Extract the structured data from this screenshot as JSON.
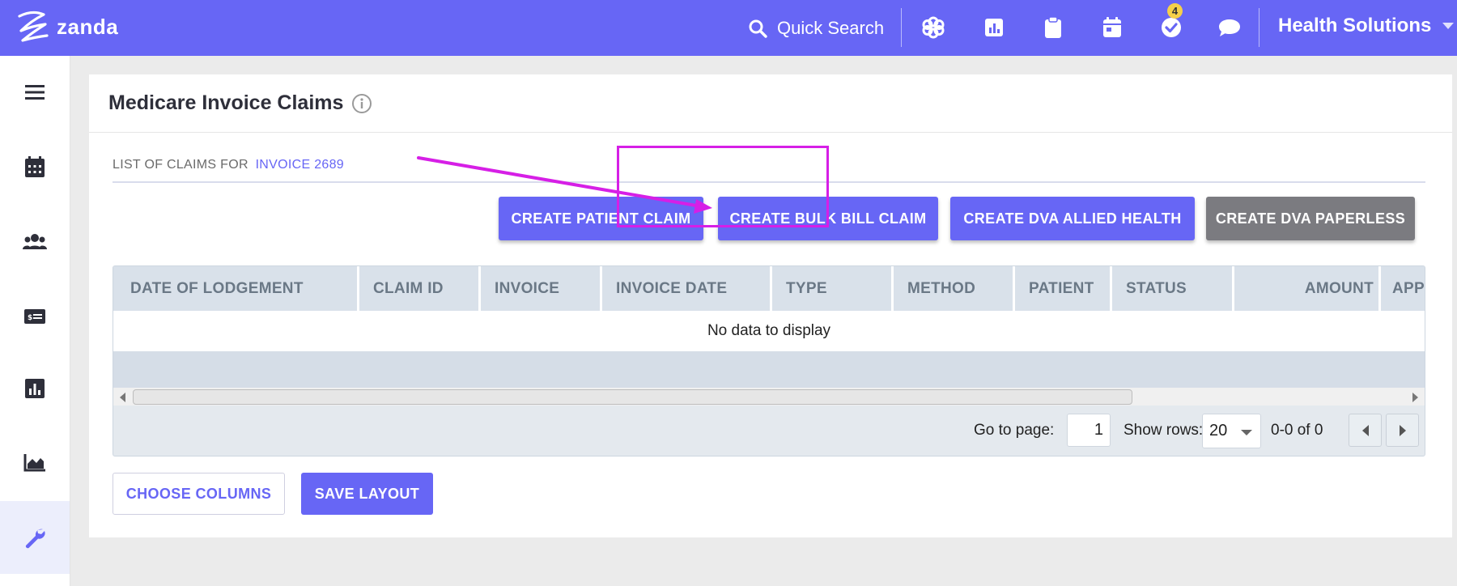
{
  "topbar": {
    "logo_text": "zanda",
    "quick_search_label": "Quick Search",
    "notification_count": "4",
    "org_name": "Health Solutions",
    "icons": [
      "flower-icon",
      "report-icon",
      "clipboard-icon",
      "calendar-icon",
      "tasks-check-icon",
      "chat-icon"
    ]
  },
  "sidebar": {
    "items": [
      "menu-icon",
      "calendar-icon",
      "clients-icon",
      "billing-icon",
      "reports-icon",
      "analytics-icon",
      "settings-wrench-icon"
    ],
    "active": "settings-wrench-icon"
  },
  "page": {
    "title": "Medicare Invoice Claims",
    "claims_label": "LIST OF CLAIMS FOR",
    "invoice_link": "INVOICE 2689"
  },
  "actions": {
    "create_patient_claim": "CREATE PATIENT CLAIM",
    "create_bulk_bill_claim": "CREATE BULK BILL CLAIM",
    "create_dva_allied_health": "CREATE DVA ALLIED HEALTH",
    "create_dva_paperless": "CREATE DVA PAPERLESS"
  },
  "grid": {
    "columns": [
      "DATE OF LODGEMENT",
      "CLAIM ID",
      "INVOICE",
      "INVOICE DATE",
      "TYPE",
      "METHOD",
      "PATIENT",
      "STATUS",
      "AMOUNT",
      "APP"
    ],
    "no_data": "No data to display"
  },
  "pager": {
    "go_to_page_label": "Go to page:",
    "page_value": "1",
    "show_rows_label": "Show rows:",
    "rows_value": "20",
    "range_text": "0-0 of 0"
  },
  "footer": {
    "choose_columns": "CHOOSE COLUMNS",
    "save_layout": "SAVE LAYOUT"
  },
  "colors": {
    "brand": "#6766f5",
    "annotation": "#d61fe6",
    "grey_button": "#7b7b80"
  }
}
